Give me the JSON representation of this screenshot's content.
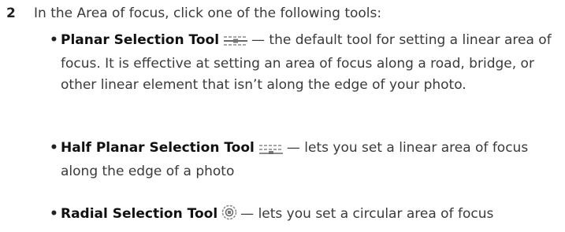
{
  "step": {
    "number": "2",
    "text": "In the Area of focus, click one of the following tools:"
  },
  "bullets": [
    {
      "term": "Planar Selection Tool",
      "icon": "planar-selection-icon",
      "description": "— the default tool for setting a linear area of focus. It is effective at setting an area of focus along a road, bridge, or other linear element that isn’t along the edge of your photo."
    },
    {
      "term": "Half Planar Selection Tool",
      "icon": "half-planar-selection-icon",
      "description": "— lets you set a linear area of focus along the edge of a photo"
    },
    {
      "term": "Radial Selection Tool",
      "icon": "radial-selection-icon",
      "description": "— lets you set a circular area of focus"
    }
  ],
  "colors": {
    "text": "#3a3a3a",
    "icon_stroke": "#7a7a7a"
  }
}
